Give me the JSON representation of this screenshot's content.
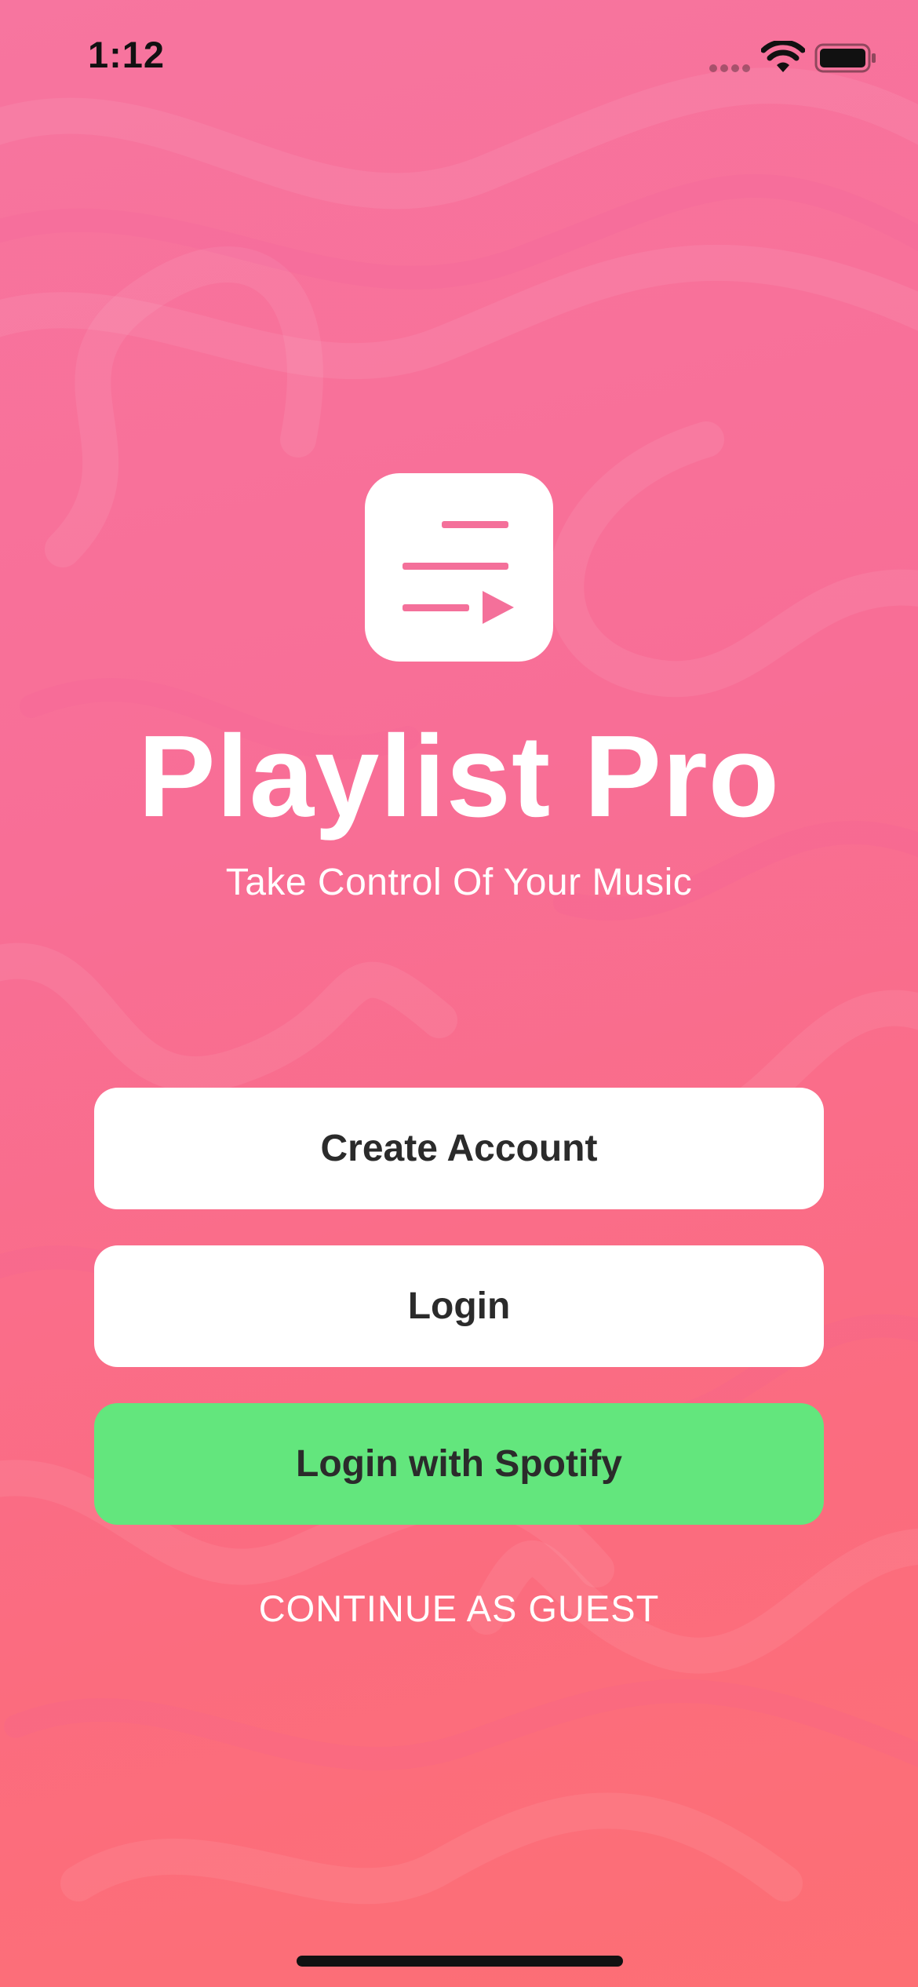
{
  "status_bar": {
    "time": "1:12",
    "icons": [
      "signal-icon",
      "wifi-icon",
      "battery-icon"
    ]
  },
  "app": {
    "icon": "playlist-play-icon",
    "title": "Playlist Pro",
    "subtitle": "Take Control Of Your Music"
  },
  "actions": {
    "create_account_label": "Create Account",
    "login_label": "Login",
    "spotify_label": "Login with Spotify",
    "guest_label": "CONTINUE AS GUEST"
  },
  "colors": {
    "background_top": "#f7759f",
    "background_bottom": "#fd6f74",
    "spotify_green": "#63e67d",
    "button_text": "#2b2b2b",
    "icon_accent": "#f4709a"
  }
}
